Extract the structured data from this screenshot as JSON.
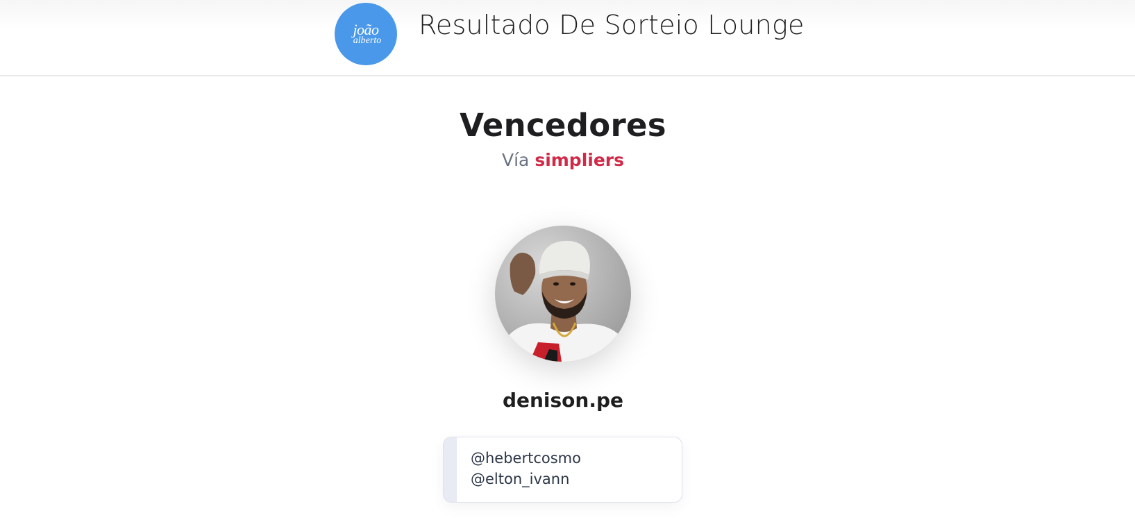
{
  "header": {
    "logo_line1": "joão",
    "logo_line2": "alberto",
    "title": "Resultado De Sorteio Lounge"
  },
  "winners": {
    "heading": "Vencedores",
    "via_prefix": "Vía",
    "via_brand": "simpliers",
    "items": [
      {
        "username": "denison.pe",
        "mentions": [
          "@hebertcosmo",
          "@elton_ivann"
        ]
      }
    ]
  },
  "colors": {
    "logo_bg": "#4a98ea",
    "brand_red": "#d02a48"
  }
}
